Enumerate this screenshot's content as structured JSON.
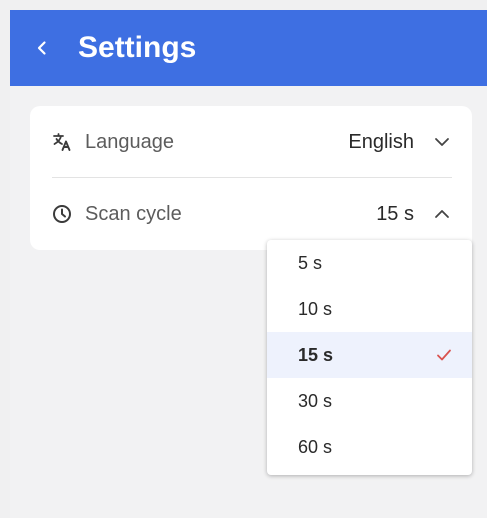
{
  "header": {
    "title": "Settings",
    "back_icon": "chevron-left-icon",
    "color": "#3e6fe2"
  },
  "settings": {
    "language": {
      "label": "Language",
      "value": "English",
      "icon": "translate-icon",
      "chevron": "chevron-down-icon"
    },
    "scan_cycle": {
      "label": "Scan cycle",
      "value": "15 s",
      "icon": "clock-icon",
      "chevron": "chevron-up-icon"
    }
  },
  "dropdown": {
    "options": [
      "5 s",
      "10 s",
      "15 s",
      "30 s",
      "60 s"
    ],
    "selected": "15 s",
    "check_color": "#d9534f",
    "selected_bg": "#eef2fd"
  }
}
